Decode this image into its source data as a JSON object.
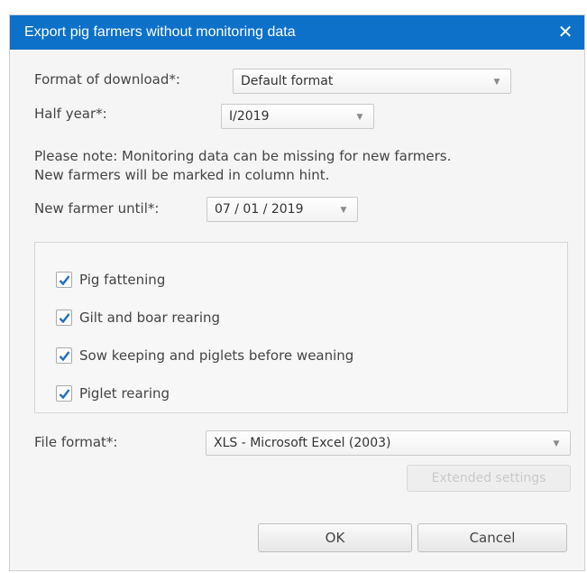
{
  "dialog": {
    "title": "Export pig farmers without monitoring data",
    "close_label": "✕"
  },
  "form": {
    "format_of_download": {
      "label": "Format of download*:",
      "value": "Default format"
    },
    "half_year": {
      "label": "Half year*:",
      "value": "I/2019"
    },
    "note": [
      "Please note: Monitoring data can be missing for new farmers.",
      "New farmers will be marked in column hint."
    ],
    "new_farmer_until": {
      "label": "New farmer until*:",
      "value": "07 / 01 / 2019"
    },
    "categories": [
      {
        "label": "Pig fattening",
        "checked": true
      },
      {
        "label": "Gilt and boar rearing",
        "checked": true
      },
      {
        "label": "Sow keeping and piglets before weaning",
        "checked": true
      },
      {
        "label": "Piglet rearing",
        "checked": true
      }
    ],
    "file_format": {
      "label": "File format*:",
      "value": "XLS - Microsoft Excel (2003)"
    }
  },
  "buttons": {
    "extended_settings": "Extended settings",
    "ok": "OK",
    "cancel": "Cancel"
  },
  "colors": {
    "titlebar": "#0d71c9",
    "checkmark": "#1f6fc2"
  }
}
